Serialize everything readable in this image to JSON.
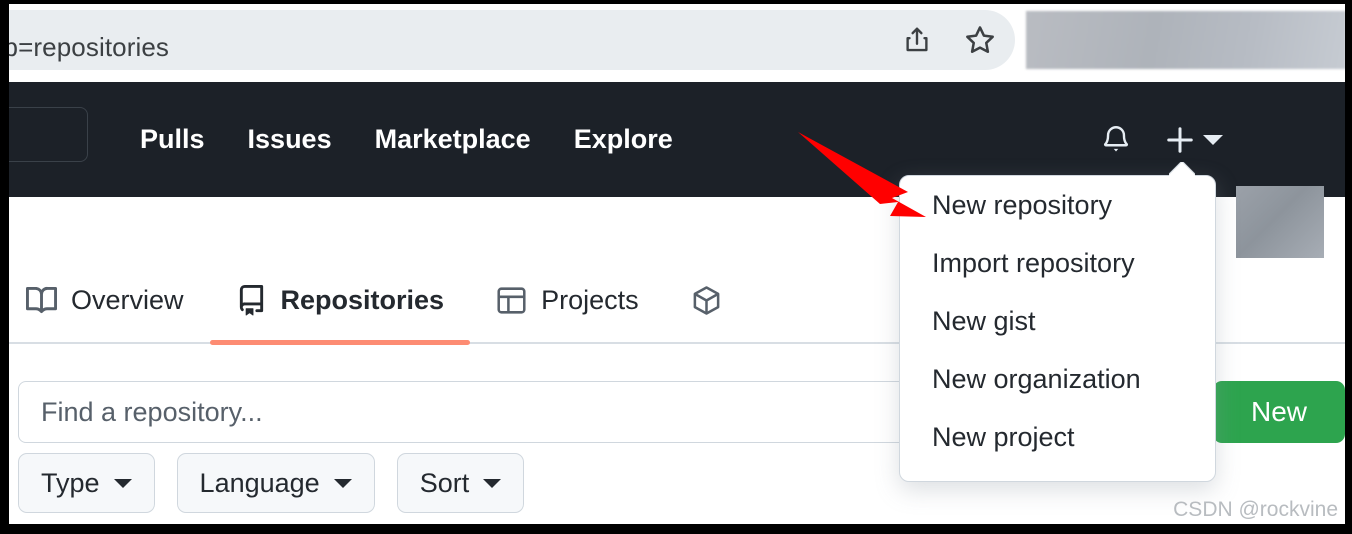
{
  "browser": {
    "address_value": "ab=repositories",
    "share_icon": "share-icon",
    "bookmark_icon": "star-icon"
  },
  "gh_nav": {
    "search_shortcut": "/",
    "links": [
      {
        "label": "Pulls"
      },
      {
        "label": "Issues"
      },
      {
        "label": "Marketplace"
      },
      {
        "label": "Explore"
      }
    ],
    "notifications_icon": "bell-icon",
    "create_new_icon": "plus-icon",
    "create_new_caret": "chevron-down-icon"
  },
  "create_menu": {
    "items": [
      {
        "label": "New repository"
      },
      {
        "label": "Import repository"
      },
      {
        "label": "New gist"
      },
      {
        "label": "New organization"
      },
      {
        "label": "New project"
      }
    ]
  },
  "profile_tabs": {
    "items": [
      {
        "label": "Overview",
        "icon": "book-icon",
        "active": false
      },
      {
        "label": "Repositories",
        "icon": "repo-icon",
        "active": true
      },
      {
        "label": "Projects",
        "icon": "table-icon",
        "active": false
      },
      {
        "label": "",
        "icon": "package-icon",
        "active": false
      }
    ],
    "overflow_label": "..."
  },
  "repo_toolbar": {
    "search_placeholder": "Find a repository...",
    "search_value": "",
    "new_button_label": "New",
    "filters": [
      {
        "label": "Type"
      },
      {
        "label": "Language"
      },
      {
        "label": "Sort"
      }
    ]
  },
  "annotation": {
    "arrow_color": "#ff0000",
    "points_to": "New repository"
  },
  "watermark": {
    "text": "CSDN @rockvine"
  },
  "colors": {
    "nav_background": "#1c2128",
    "accent_green": "#2da44e",
    "active_tab_underline": "#fd8c73",
    "border": "#d0d7de"
  }
}
